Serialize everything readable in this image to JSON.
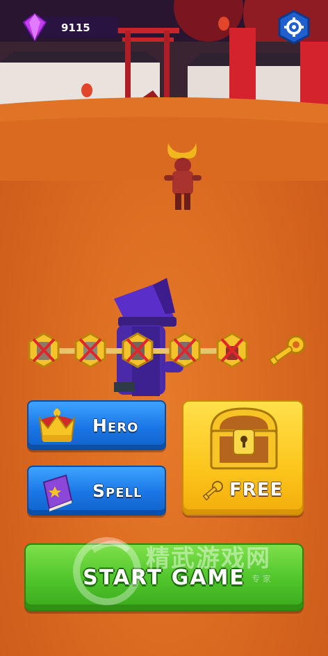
{
  "hud": {
    "gem_count": "9115",
    "gem_icon": "purple-gem-icon",
    "settings_icon": "gear-icon"
  },
  "progress": {
    "levels": [
      {
        "status": "defeated"
      },
      {
        "status": "defeated"
      },
      {
        "status": "defeated"
      },
      {
        "status": "defeated"
      },
      {
        "status": "defeated"
      }
    ],
    "reward_icon": "golden-key-icon"
  },
  "buttons": {
    "hero_label": "Hero",
    "spell_label": "Spell",
    "chest_label": "FREE",
    "start_label": "START GAME"
  },
  "watermark": {
    "text": "精武游戏网",
    "subtext": "专 家"
  },
  "colors": {
    "ground": "#da6a20",
    "blue_button": "#1a76e6",
    "chest_button": "#fcc51c",
    "start_button": "#4ec42a",
    "gem_bar": "#28144a"
  }
}
